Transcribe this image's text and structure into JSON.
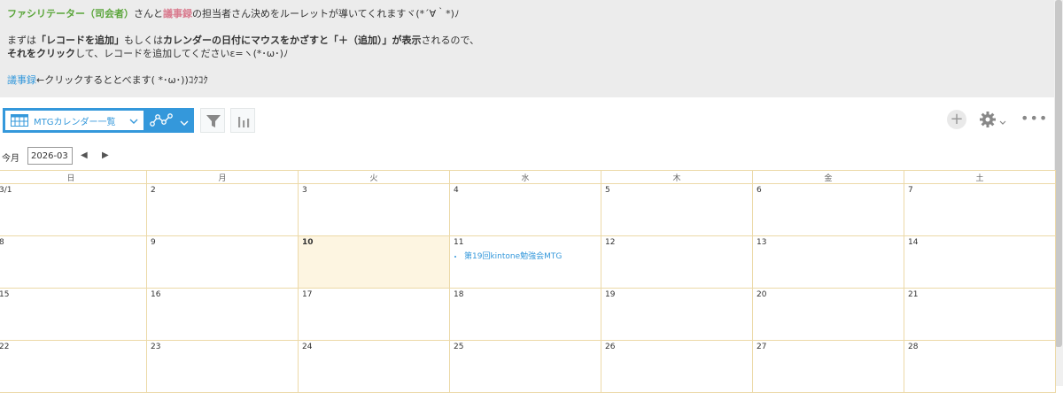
{
  "notice": {
    "line1": {
      "part1": "ファシリテーター（司会者）",
      "part2": "さんと",
      "part3": "議事録",
      "part4": "の担当者さん決めをルーレットが導いてくれますヾ(*´∀｀*)ﾉ"
    },
    "line2": {
      "part1": "まずは",
      "part2": "「レコードを追加」",
      "part3": "もしくは",
      "part4": "カレンダーの日付にマウスをかざすと「＋（追加）」が表示",
      "part5": "されるので、"
    },
    "line3": {
      "part1": "それをクリック",
      "part2": "して、レコードを追加してくださいε=ヽ(*･ω･)ﾉ"
    },
    "line4": {
      "part1": "議事録",
      "part2": "←クリックするととべます( *･ω･))ｺｸｺｸ"
    }
  },
  "toolbar": {
    "view_label": "MTGカレンダー一覧",
    "filter_icon": "funnel-icon",
    "graph_icon": "bar-chart-icon",
    "add_icon": "plus-icon",
    "settings_icon": "gear-icon",
    "more_label": "•••"
  },
  "nav": {
    "today_label": "今月",
    "month_value": "2026-03",
    "prev_label": "◀",
    "next_label": "▶"
  },
  "calendar": {
    "weekdays": [
      "日",
      "月",
      "火",
      "水",
      "木",
      "金",
      "土"
    ],
    "weeks": [
      [
        "3/1",
        "2",
        "3",
        "4",
        "5",
        "6",
        "7"
      ],
      [
        "8",
        "9",
        "10",
        "11",
        "12",
        "13",
        "14"
      ],
      [
        "15",
        "16",
        "17",
        "18",
        "19",
        "20",
        "21"
      ],
      [
        "22",
        "23",
        "24",
        "25",
        "26",
        "27",
        "28"
      ]
    ],
    "event_title": "第19回kintone勉強会MTG",
    "highlight_color": "#fdf5e1",
    "accent_color": "#3498db"
  }
}
